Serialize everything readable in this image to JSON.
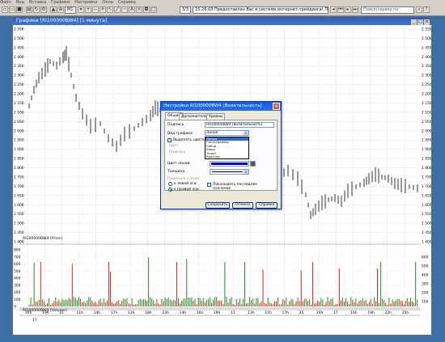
{
  "menubar": [
    "Файл",
    "Вид",
    "Вставка",
    "Графики",
    "Настройки",
    "Окна",
    "Справка"
  ],
  "toolbar": {
    "period_value": "М1",
    "spin_value": "3/3",
    "news_text": "15:26:03 Предоставлен Вас в системе интернет-трейдинга! При подаче пор",
    "search_placeholder": "Поиск/сервер по"
  },
  "chart_window": {
    "title": "Графики [RI100000BW4]  [1 минута]",
    "price_panel": {
      "y_ticks": [
        "2 550",
        "2 500",
        "2 450",
        "2 400",
        "2 350",
        "2 300",
        "2 250",
        "2 200",
        "2 150",
        "2 100",
        "2 050",
        "2 000",
        "1 950",
        "1 900",
        "1 850",
        "1 800",
        "1 750",
        "1 700",
        "1 650",
        "1 600",
        "1 550",
        "1 500",
        "1 450",
        "1 400"
      ],
      "label": "RI100000BW4 [Price]"
    },
    "volume_panel": {
      "y_ticks": [
        "800",
        "700",
        "600",
        "500",
        "400",
        "300",
        "200",
        "100",
        "0"
      ],
      "right_ticks": [
        "600",
        "500",
        "400",
        "300",
        "200",
        "100"
      ],
      "label": "RI100000BW4 [Volume]"
    },
    "x_ticks": [
      "16h",
      "19h",
      "21",
      "11h",
      "14h",
      "17h",
      "12h",
      "18h",
      "23h",
      "14h",
      "16h",
      "19h",
      "11",
      "13h",
      "11h",
      "17h",
      "25",
      "20h",
      "17",
      "16h",
      "19h",
      "22h",
      "25h"
    ],
    "date_label": "17"
  },
  "dialog": {
    "title": "Настройки RI100000BW4 (Волатильность)",
    "close_label": "×",
    "tabs": [
      "Общие",
      "Дополнительно",
      "Уровни"
    ],
    "caption_label": "Подпись",
    "caption_value": "RI100000BW4 (Волатильность)",
    "chart_type_label": "Вид графика",
    "chart_type_value": "Линия",
    "highlight_label": "Выделять цветом",
    "color_label": "Цвет",
    "edge_label": "Подпись",
    "line_color_label": "Цвет линии",
    "thickness_label": "Толщина",
    "binding_label": "Привязка к осям",
    "left_axis_label": "к левой оси",
    "right_axis_label": "к правой оси",
    "show_last_label": "Показывать последнее значение",
    "chart_type_options": [
      "Линия",
      "Гистограммы",
      "Свечи",
      "Бары",
      "Точки",
      "Крестик"
    ],
    "selected_option_index": 0,
    "line_color": "#0000cc",
    "ok_label": "Сохранить",
    "cancel_label": "Отмена",
    "help_label": "Справка"
  },
  "colors": {
    "desktop": "#3a6ea5",
    "volume_up": "#2a8a2a",
    "volume_down": "#d02818",
    "candle": "#000000"
  }
}
